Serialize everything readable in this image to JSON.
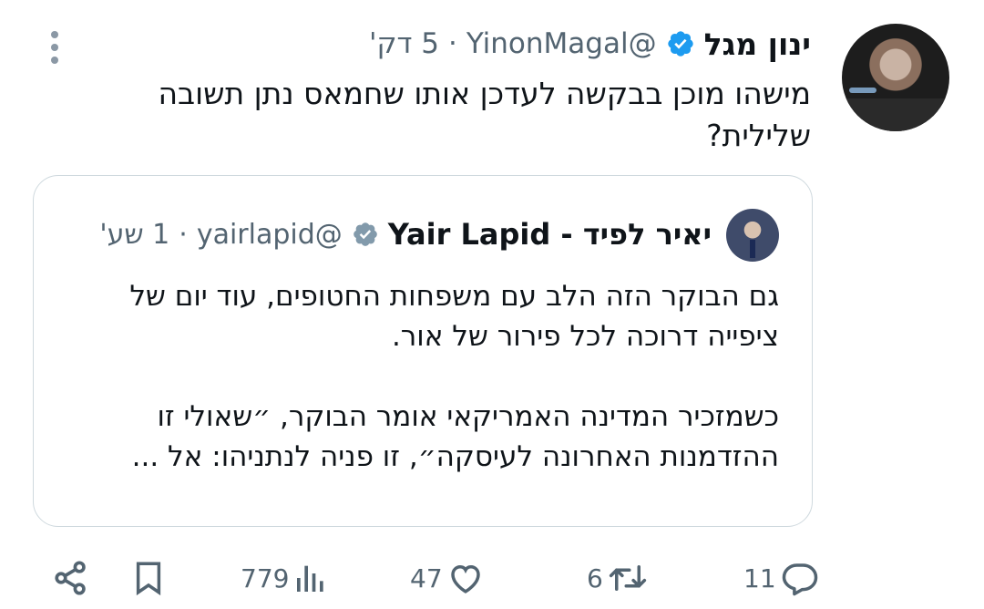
{
  "tweet": {
    "author_name": "ינון מגל",
    "handle": "@YinonMagal",
    "separator": "·",
    "time": "5 דק'",
    "text_lines": [
      "מישהו מוכן בבקשה לעדכן אותו שחמאס נתן תשובה",
      "שלילית?"
    ]
  },
  "quote": {
    "author_name": "יאיר לפיד - Yair Lapid",
    "handle": "@yairlapid",
    "separator": "·",
    "time": "1 שע'",
    "paragraph1_lines": [
      "גם הבוקר הזה הלב עם משפחות החטופים, עוד יום של",
      "ציפייה דרוכה לכל פירור של אור."
    ],
    "paragraph2_lines": [
      "כשמזכיר המדינה האמריקאי אומר הבוקר, ״שאולי זו",
      "ההזדמנות האחרונה לעיסקה״, זו פניה  לנתניהו: אל ..."
    ]
  },
  "actions": {
    "replies": "11",
    "retweets": "6",
    "likes": "47",
    "views": "779"
  },
  "colors": {
    "verified": "#1d9bf0",
    "verified_gray": "#829aab",
    "muted_text": "#536471",
    "border": "#cfd9de"
  },
  "icons": [
    "more-vertical-icon",
    "verified-badge-icon",
    "reply-icon",
    "retweet-icon",
    "like-icon",
    "views-icon",
    "bookmark-icon",
    "share-icon"
  ]
}
